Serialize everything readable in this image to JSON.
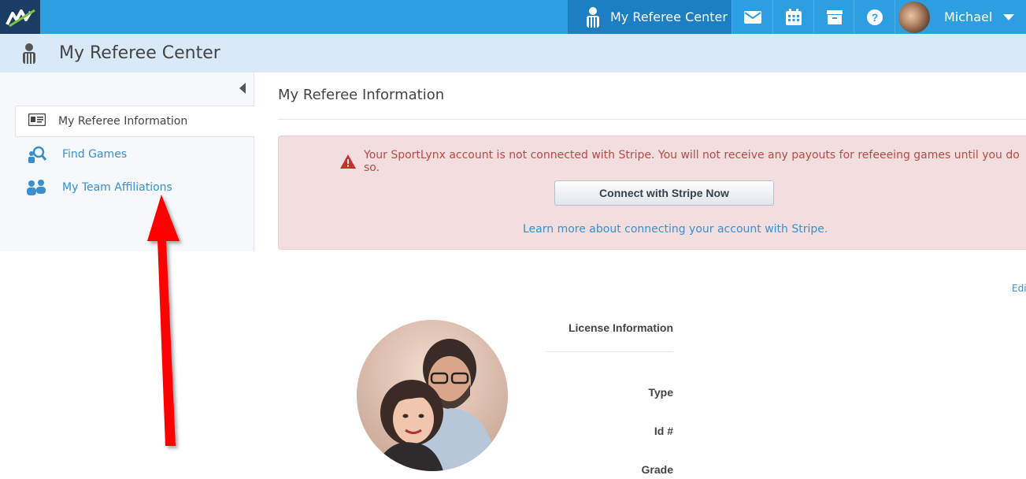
{
  "topbar": {
    "active_nav_label": "My Referee Center",
    "icons": [
      "mail-icon",
      "calendar-icon",
      "archive-icon",
      "help-icon"
    ],
    "user_name": "Michael"
  },
  "subheader": {
    "title": "My Referee Center"
  },
  "sidebar": {
    "items": [
      {
        "label": "My Referee Information",
        "icon": "id-card-icon",
        "active": true
      },
      {
        "label": "Find Games",
        "icon": "find-games-icon",
        "active": false
      },
      {
        "label": "My Team Affiliations",
        "icon": "team-icon",
        "active": false
      }
    ]
  },
  "main": {
    "title": "My Referee Information",
    "alert": {
      "message": "Your SportLynx account is not connected with Stripe. You will not receive any payouts for refeeeing games until you do so.",
      "button_label": "Connect with Stripe Now",
      "link_text": "Learn more about connecting your account with Stripe."
    },
    "edit_link": "Edi",
    "license": {
      "heading": "License Information",
      "labels": [
        "Type",
        "Id #",
        "Grade"
      ]
    }
  },
  "colors": {
    "topbar": "#2d9ee0",
    "topbar_active": "#1c7fc4",
    "logo_bg": "#1b3d63",
    "subheader": "#d9e9f7",
    "alert_bg": "#f2dede",
    "alert_text": "#b94a48",
    "link": "#3a8fd0",
    "annotation_arrow": "#ff0000"
  }
}
